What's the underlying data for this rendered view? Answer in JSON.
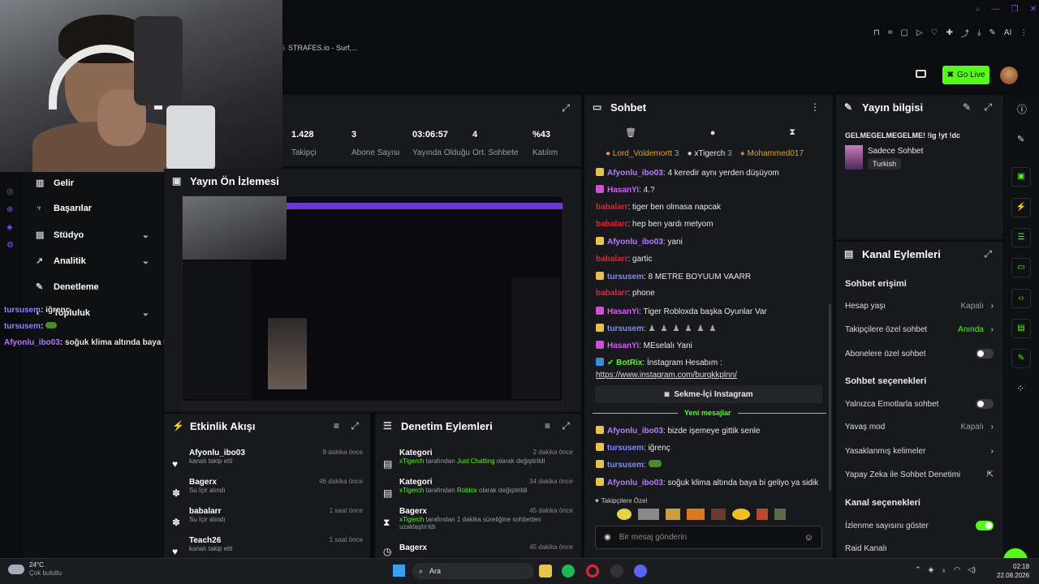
{
  "browser": {
    "tab_title": "STRAFES.io - Surf,..."
  },
  "header": {
    "go_live": "Go Live"
  },
  "stats": [
    {
      "value": "1.428",
      "label": "Takipçi"
    },
    {
      "value": "3",
      "label": "Abone Sayısı"
    },
    {
      "value": "03:06:57",
      "label": "Yayında Olduğu"
    },
    {
      "value": "4",
      "label": "Ort. Sohbete"
    },
    {
      "value": "%43",
      "label": "Katılım"
    }
  ],
  "sidebar": {
    "items": [
      "Gelir",
      "Başarılar",
      "Stüdyo",
      "Analitik",
      "Denetleme",
      "Topluluk"
    ]
  },
  "overlay_chat": [
    {
      "user": "tursusem",
      "text": ": iğrenç"
    },
    {
      "user": "tursusem",
      "text": ":"
    },
    {
      "user": "Afyonlu_ibo03",
      "text": ": soğuk klima altında baya bi geliyo ya sidik"
    }
  ],
  "preview": {
    "title": "Yayın Ön İzlemesi"
  },
  "activity": {
    "title": "Etkinlik Akışı",
    "items": [
      {
        "user": "Afyonlu_ibo03",
        "detail": "kanalı takip etti",
        "time": "8 dakika önce"
      },
      {
        "user": "Bagerx",
        "detail": "Su İçir alındı",
        "time": "46 dakika önce"
      },
      {
        "user": "babalarr",
        "detail": "Su İçir alındı",
        "time": "1 saat önce"
      },
      {
        "user": "Teach26",
        "detail": "kanalı takip etti",
        "time": "1 saat önce"
      }
    ]
  },
  "moderation": {
    "title": "Denetim Eylemleri",
    "items": [
      {
        "title": "Kategori",
        "time": "2 dakika önce",
        "by": "xTigerch",
        "mid": " tarafından ",
        "target": "Just Chatting",
        "end": " olarak değiştirildi"
      },
      {
        "title": "Kategori",
        "time": "34 dakika önce",
        "by": "xTigerch",
        "mid": " tarafından ",
        "target": "Roblox",
        "end": " olarak değiştirildi"
      },
      {
        "title": "Bagerx",
        "time": "45 dakika önce",
        "by": "xTigerch",
        "mid": " tarafından 1 dakika süreliğine sohbetten",
        "target": "",
        "end": "uzaklaştırıldı"
      },
      {
        "title": "Bagerx",
        "time": "45 dakika önce",
        "by": "xTigerch",
        "mid": "",
        "target": "",
        "end": ""
      }
    ]
  },
  "chat": {
    "title": "Sohbet",
    "top_chatters": [
      {
        "name": "Lord_Voldemortt",
        "count": "3"
      },
      {
        "name": "xTigerch",
        "count": "3"
      },
      {
        "name": "Mohammed017",
        "count": ""
      }
    ],
    "messages": [
      {
        "user": "Afyonlu_ibo03",
        "text": ": 4 keredir aynı yerden düşüyom",
        "color": "#b87cff",
        "badge": "y"
      },
      {
        "user": "HasanYi",
        "text": ": 4.?",
        "color": "#d45cff",
        "badge": "p"
      },
      {
        "user": "babalarr",
        "text": ": tiger ben olmasa napcak",
        "color": "#e0243b",
        "badge": ""
      },
      {
        "user": "babalarr",
        "text": ": hep ben yardı metyom",
        "color": "#e0243b",
        "badge": ""
      },
      {
        "user": "Afyonlu_ibo03",
        "text": ": yani",
        "color": "#b87cff",
        "badge": "y"
      },
      {
        "user": "babalarr",
        "text": ": gartic",
        "color": "#e0243b",
        "badge": ""
      },
      {
        "user": "tursusem",
        "text": ": 8 METRE BOYUUM VAARR",
        "color": "#7c8cff",
        "badge": "y"
      },
      {
        "user": "babalarr",
        "text": ": phone",
        "color": "#e0243b",
        "badge": ""
      },
      {
        "user": "HasanYi",
        "text": ": Tiger Robloxda başka Oyunlar Var",
        "color": "#d45cff",
        "badge": "p"
      },
      {
        "user": "tursusem",
        "text": ":",
        "color": "#7c8cff",
        "badge": "y"
      },
      {
        "user": "HasanYi",
        "text": ": MEselalı Yani",
        "color": "#d45cff",
        "badge": "p"
      },
      {
        "user": "BotRix",
        "text": ": İnstagram Hesabım :",
        "color": "#53fc18",
        "badge": "b"
      }
    ],
    "link": "https://www.instagram.com/burqkkplnn/",
    "instagram_button": "Sekme-İçi Instagram",
    "new_messages": "Yeni mesajlar",
    "new": [
      {
        "user": "Afyonlu_ibo03",
        "text": ": bizde işemeye gittik senle",
        "color": "#b87cff"
      },
      {
        "user": "tursusem",
        "text": ": iğrenç",
        "color": "#7c8cff"
      },
      {
        "user": "tursusem",
        "text": ":",
        "color": "#7c8cff"
      },
      {
        "user": "Afyonlu_ibo03",
        "text": ": soğuk klima altında baya bi geliyo ya sidik",
        "color": "#b87cff"
      }
    ],
    "followers_only": "Takipçilere Özel",
    "placeholder": "Bir mesaj gönderin"
  },
  "stream_info": {
    "title": "Yayın bilgisi",
    "stream_title": "GELMEGELMEGELME! !ig !yt !dc",
    "category": "Sadece Sohbet",
    "language": "Turkish"
  },
  "channel_actions": {
    "title": "Kanal Eylemleri",
    "chat_access": "Sohbet erişimi",
    "account_age": {
      "label": "Hesap yaşı",
      "value": "Kapalı"
    },
    "followers_chat": {
      "label": "Takipçilere özel sohbet",
      "value": "Anında"
    },
    "subs_chat": {
      "label": "Abonelere özel sohbet"
    },
    "chat_options": "Sohbet seçenekleri",
    "emote_only": {
      "label": "Yalnızca Emotlarla sohbet"
    },
    "slow_mode": {
      "label": "Yavaş mod",
      "value": "Kapalı"
    },
    "banned_words": {
      "label": "Yasaklanmış kelimeler"
    },
    "ai_mod": {
      "label": "Yapay Zeka ile Sohbet Denetimi"
    },
    "channel_options": "Kanal seçenekleri",
    "show_views": {
      "label": "İzlenme sayısını göster"
    },
    "raid": {
      "label": "Raid Kanalı"
    }
  },
  "taskbar": {
    "temp": "24°C",
    "weather": "Çok bulutlu",
    "search": "Ara",
    "time": "02:18",
    "date": "22.08.2026"
  }
}
